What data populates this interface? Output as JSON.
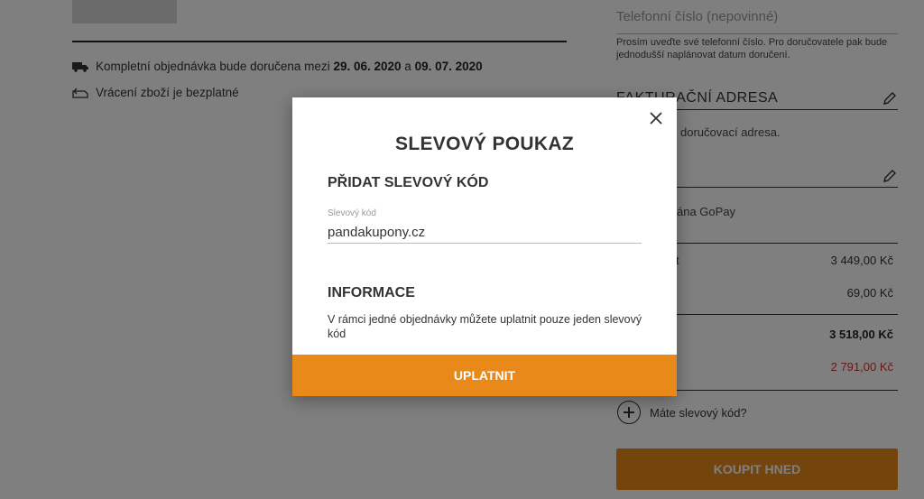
{
  "page": {
    "delivery_text": "Kompletní objednávka bude doručena mezi",
    "delivery_from": "29. 06. 2020",
    "delivery_and": "a",
    "delivery_to": "09. 07. 2020",
    "returns_text": "Vrácení zboží je bezplatné"
  },
  "right": {
    "phone_placeholder": "Telefonní číslo (nepovinné)",
    "phone_hint": "Prosím uveďte své telefonní číslo. Pro doručovatele pak bude jednodušší naplánovat datum doručení.",
    "billing_title": "FAKTURAČNÍ ADRESA",
    "billing_text": "doručovací adresa.",
    "payment_text": "ána GoPay",
    "prices": [
      {
        "label": "t",
        "value": "3 449,00 Kč"
      },
      {
        "label": "",
        "value": "69,00 Kč"
      },
      {
        "label": "",
        "value": "3 518,00 Kč"
      },
      {
        "label": "",
        "value": "2 791,00 Kč"
      }
    ],
    "voucher_link": "Máte slevový kód?",
    "buy_button": "KOUPIT HNED"
  },
  "modal": {
    "title": "SLEVOVÝ POUKAZ",
    "subtitle": "PŘIDAT SLEVOVÝ KÓD",
    "field_label": "Slevový kód",
    "field_value": "pandakupony.cz",
    "info_title": "INFORMACE",
    "info_text": "V rámci jedné objednávky můžete uplatnit pouze jeden slevový kód",
    "apply_button": "UPLATNIT"
  },
  "colors": {
    "accent": "#e8891a",
    "discount_red": "#d32f2f",
    "overlay": "rgba(0,0,0,0.5)"
  },
  "icons": [
    "truck-icon",
    "return-icon",
    "pencil-icon",
    "plus-circle-icon",
    "close-icon"
  ]
}
